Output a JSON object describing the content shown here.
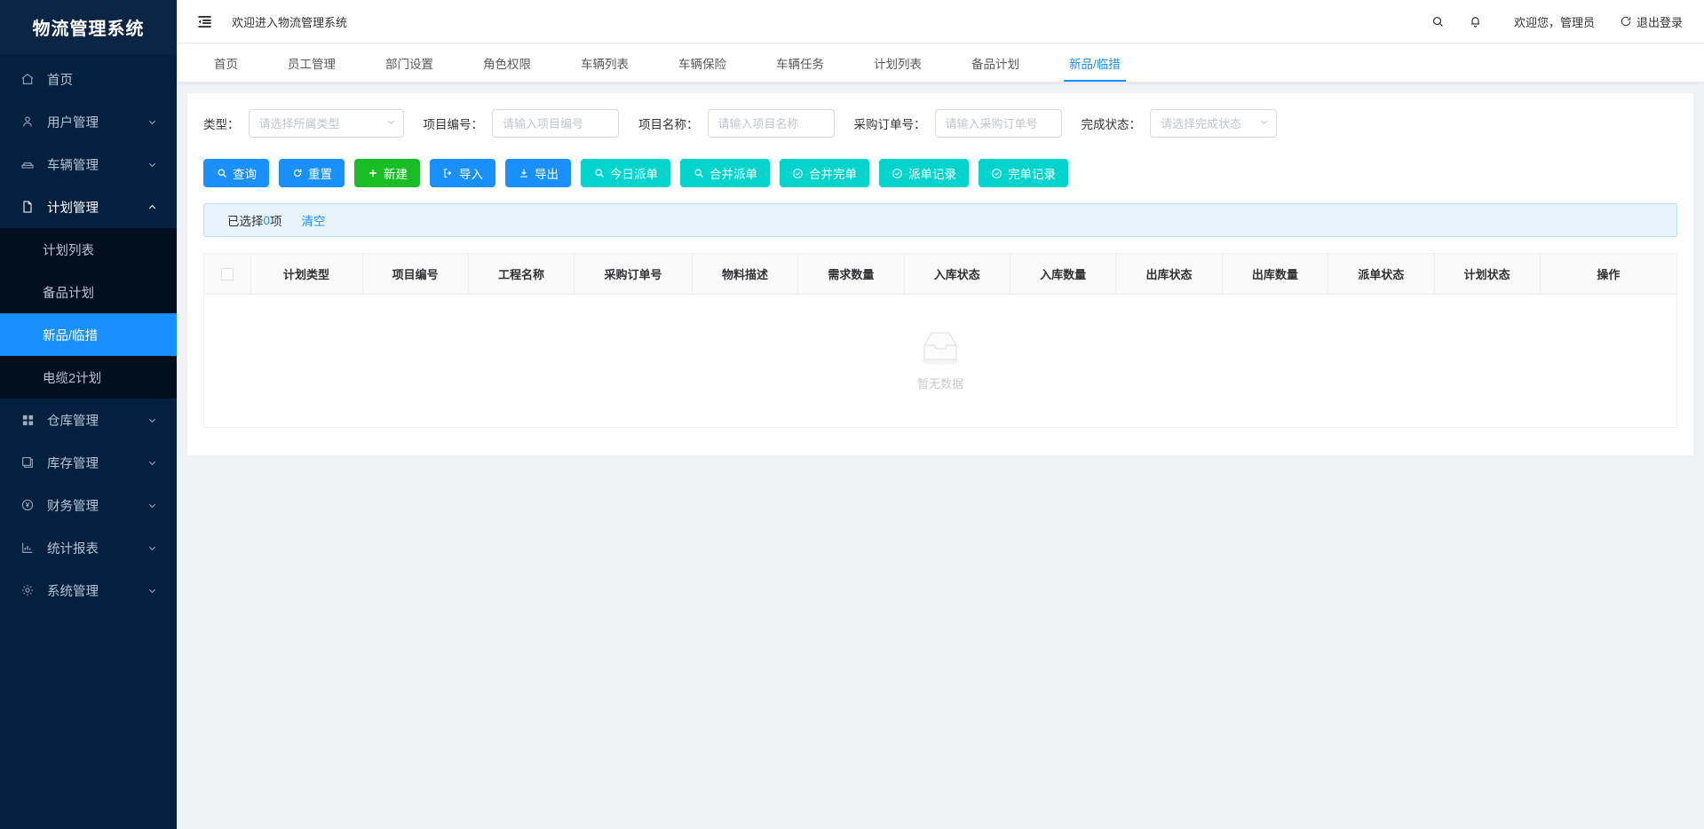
{
  "app": {
    "brand": "物流管理系统",
    "accent_blue": "#1890ff",
    "accent_green": "#19be26",
    "accent_cyan": "#00d4cd",
    "sidebar_bg": "#04203f"
  },
  "header": {
    "collapse_icon": "menu-fold-icon",
    "welcome": "欢迎进入物流管理系统",
    "search_icon": "search-icon",
    "bell_icon": "bell-icon",
    "greeting": "欢迎您，管理员",
    "logout_icon": "logout-icon",
    "logout_label": "退出登录"
  },
  "sidebar": {
    "items": [
      {
        "label": "首页",
        "icon": "home-icon",
        "expandable": false,
        "active": false
      },
      {
        "label": "用户管理",
        "icon": "user-icon",
        "expandable": true,
        "active": false,
        "arrow": "chevron-down-icon"
      },
      {
        "label": "车辆管理",
        "icon": "car-icon",
        "expandable": true,
        "active": false,
        "arrow": "chevron-down-icon"
      },
      {
        "label": "计划管理",
        "icon": "document-icon",
        "expandable": true,
        "active": true,
        "arrow": "chevron-up-icon"
      },
      {
        "label": "仓库管理",
        "icon": "grid-icon",
        "expandable": true,
        "active": false,
        "arrow": "chevron-down-icon"
      },
      {
        "label": "库存管理",
        "icon": "box-icon",
        "expandable": true,
        "active": false,
        "arrow": "chevron-down-icon"
      },
      {
        "label": "财务管理",
        "icon": "yuan-coin-icon",
        "expandable": true,
        "active": false,
        "arrow": "chevron-down-icon"
      },
      {
        "label": "统计报表",
        "icon": "bar-chart-icon",
        "expandable": true,
        "active": false,
        "arrow": "chevron-down-icon"
      },
      {
        "label": "系统管理",
        "icon": "gear-icon",
        "expandable": true,
        "active": false,
        "arrow": "chevron-down-icon"
      }
    ],
    "submenu": [
      {
        "label": "计划列表",
        "selected": false
      },
      {
        "label": "备品计划",
        "selected": false
      },
      {
        "label": "新品/临措",
        "selected": true
      },
      {
        "label": "电缆2计划",
        "selected": false
      }
    ]
  },
  "tabs": [
    {
      "label": "首页",
      "active": false
    },
    {
      "label": "员工管理",
      "active": false
    },
    {
      "label": "部门设置",
      "active": false
    },
    {
      "label": "角色权限",
      "active": false
    },
    {
      "label": "车辆列表",
      "active": false
    },
    {
      "label": "车辆保险",
      "active": false
    },
    {
      "label": "车辆任务",
      "active": false
    },
    {
      "label": "计划列表",
      "active": false
    },
    {
      "label": "备品计划",
      "active": false
    },
    {
      "label": "新品/临措",
      "active": true
    }
  ],
  "filters": [
    {
      "label": "类型：",
      "type": "select",
      "value": "",
      "placeholder": "请选择所属类型",
      "name": "type"
    },
    {
      "label": "项目编号：",
      "type": "input",
      "value": "",
      "placeholder": "请输入项目编号",
      "name": "project-no"
    },
    {
      "label": "项目名称：",
      "type": "input",
      "value": "",
      "placeholder": "请输入项目名称",
      "name": "project-name"
    },
    {
      "label": "采购订单号：",
      "type": "input",
      "value": "",
      "placeholder": "请输入采购订单号",
      "name": "purchase-order-no"
    },
    {
      "label": "完成状态：",
      "type": "select",
      "value": "",
      "placeholder": "请选择完成状态",
      "name": "complete-status"
    }
  ],
  "buttons": [
    {
      "label": "查询",
      "icon": "search-icon",
      "style": "blue"
    },
    {
      "label": "重置",
      "icon": "refresh-icon",
      "style": "blue"
    },
    {
      "label": "新建",
      "icon": "plus-icon",
      "style": "green"
    },
    {
      "label": "导入",
      "icon": "import-icon",
      "style": "blue"
    },
    {
      "label": "导出",
      "icon": "download-icon",
      "style": "blue"
    },
    {
      "label": "今日派单",
      "icon": "search-icon",
      "style": "cyan"
    },
    {
      "label": "合并派单",
      "icon": "search-icon",
      "style": "cyan"
    },
    {
      "label": "合并完单",
      "icon": "check-circle-icon",
      "style": "cyan"
    },
    {
      "label": "派单记录",
      "icon": "check-circle-icon",
      "style": "cyan"
    },
    {
      "label": "完单记录",
      "icon": "check-circle-icon",
      "style": "cyan"
    }
  ],
  "selection_bar": {
    "prefix": "已选择 ",
    "count": "0",
    "suffix": "项",
    "clear_label": "清空"
  },
  "table": {
    "columns": [
      "计划类型",
      "项目编号",
      "工程名称",
      "采购订单号",
      "物料描述",
      "需求数量",
      "入库状态",
      "入库数量",
      "出库状态",
      "出库数量",
      "派单状态",
      "计划状态",
      "操作"
    ],
    "rows": [],
    "empty_text": "暂无数据",
    "empty_icon": "empty-inbox-icon",
    "select_all_checked": false
  }
}
